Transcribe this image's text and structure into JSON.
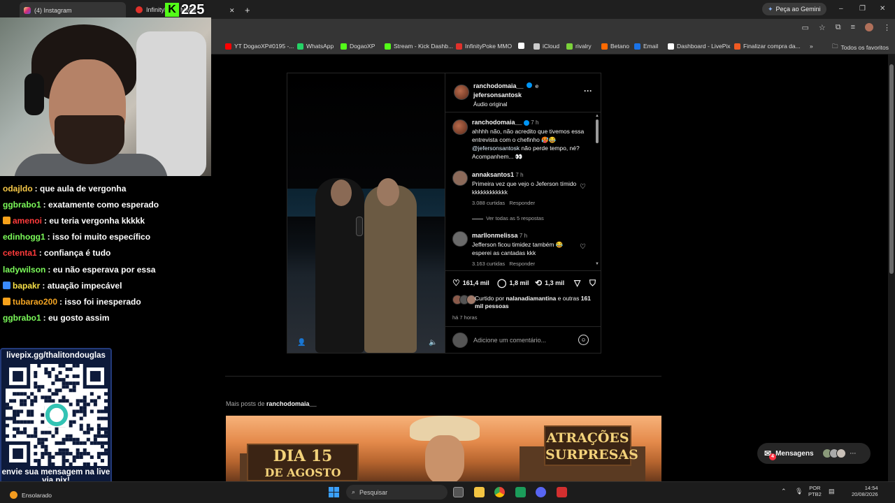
{
  "browser": {
    "tabs": [
      {
        "label": "(4) Instagram",
        "active": true
      },
      {
        "label": "InfinityPoke MMO",
        "active": false
      }
    ],
    "new_tab": "+",
    "gemini_label": "Peça ao Gemini",
    "bookmarks": [
      {
        "label": "YT DogaoXP#0195 -...",
        "color": "#ff0000"
      },
      {
        "label": "WhatsApp",
        "color": "#25d366"
      },
      {
        "label": "DogaoXP",
        "color": "#53fc18"
      },
      {
        "label": "Stream - Kick Dashb...",
        "color": "#53fc18"
      },
      {
        "label": "InfinityPoke MMO",
        "color": "#e0312b"
      },
      {
        "label": "",
        "color": "#ffffff"
      },
      {
        "label": "iCloud",
        "color": "#cccccc"
      },
      {
        "label": "rivalry",
        "color": "#7bd23a"
      },
      {
        "label": "Betano",
        "color": "#ff6a00"
      },
      {
        "label": "Email",
        "color": "#1a73e8"
      },
      {
        "label": "Dashboard - LivePix",
        "color": "#ffffff"
      },
      {
        "label": "Finalizar compra da...",
        "color": "#f05a22"
      }
    ],
    "all_bookmarks": "Todos os favoritos"
  },
  "stream": {
    "kick_count": "225",
    "chat": [
      {
        "user": "odajldo",
        "color": "#f7c948",
        "text": ": que aula de vergonha"
      },
      {
        "user": "ggbrabo1",
        "color": "#7cfc5a",
        "text": ": exatamente como esperado"
      },
      {
        "user": "amenoi",
        "color": "#ff3b3b",
        "text": ": eu teria vergonha kkkkk",
        "badge": "#f7a21b"
      },
      {
        "user": "edinhogg1",
        "color": "#7cfc5a",
        "text": ": isso foi muito específico"
      },
      {
        "user": "cetenta1",
        "color": "#ff3b3b",
        "text": ": confiança é tudo"
      },
      {
        "user": "ladywilson",
        "color": "#7cfc5a",
        "text": ": eu não esperava por essa"
      },
      {
        "user": "bapakr",
        "color": "#f7e048",
        "text": ": atuação impecável",
        "badge": "#3a8bff"
      },
      {
        "user": "tubarao200",
        "color": "#f5a623",
        "text": ": isso foi inesperado",
        "badge": "#f7a21b"
      },
      {
        "user": "ggbrabo1",
        "color": "#7cfc5a",
        "text": ": eu gosto assim"
      }
    ],
    "livepix_url": "livepix.gg/thalitondouglas",
    "livepix_footer": "envie sua mensagem na live via pix!"
  },
  "post": {
    "header": {
      "user1": "ranchodomaia__",
      "joiner": "e",
      "user2": "jefersonsantosk",
      "audio": "Áudio original"
    },
    "caption": {
      "user": "ranchodomaia__",
      "time": "7 h",
      "text": "ahhhh não, não acredito que tivemos essa entrevista com o chefinho 🥵😂",
      "mention": "@jefersonsantosk",
      "text2": "não perde tempo, né? Acompanhem... 👀"
    },
    "comments": [
      {
        "user": "annaksantos1",
        "time": "7 h",
        "text": "Primeira vez que vejo o Jeferson tímido kkkkkkkkkkkk",
        "likes": "3.088 curtidas",
        "reply": "Responder",
        "view_replies": "Ver todas as 5 respostas"
      },
      {
        "user": "marllonmelissa",
        "time": "7 h",
        "text": "Jefferson ficou timidez também 😂 esperei as cantadas kkk",
        "likes": "3.163 curtidas",
        "reply": "Responder"
      }
    ],
    "stats": {
      "likes": "161,4 mil",
      "comments": "1,8 mil",
      "reposts": "1,3 mil"
    },
    "liked_by_prefix": "Curtido por",
    "liked_by_user": "nalanadiamantina",
    "liked_by_suffix": "e outras",
    "liked_by_count": "161 mil pessoas",
    "posted_ago": "há 7 horas",
    "add_comment_placeholder": "Adicione um comentário..."
  },
  "more_posts": {
    "prefix": "Mais posts de",
    "user": "ranchodomaia__"
  },
  "banner": {
    "left_line1": "DIA 15",
    "left_line2": "DE AGOSTO",
    "right_line1": "ATRAÇÕES",
    "right_line2": "SURPRESAS"
  },
  "messages": {
    "label": "Mensagens",
    "badge": "4"
  },
  "taskbar": {
    "weather": "Ensolarado",
    "search_placeholder": "Pesquisar",
    "lang1": "POR",
    "lang2": "PTB2",
    "time": "14:54",
    "date": "20/08/2026"
  }
}
